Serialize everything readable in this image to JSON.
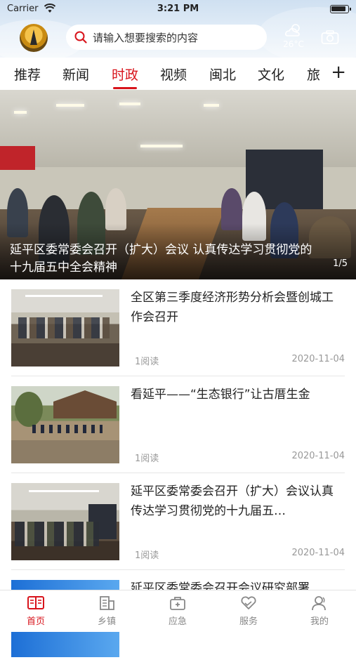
{
  "status_bar": {
    "carrier": "Carrier",
    "time": "3:21 PM"
  },
  "header": {
    "search_placeholder": "请输入想要搜索的内容",
    "weather_temp": "26°C"
  },
  "tabs": [
    {
      "label": "推荐",
      "active": false
    },
    {
      "label": "新闻",
      "active": false
    },
    {
      "label": "时政",
      "active": true
    },
    {
      "label": "视频",
      "active": false
    },
    {
      "label": "闽北",
      "active": false
    },
    {
      "label": "文化",
      "active": false
    },
    {
      "label": "旅",
      "active": false
    }
  ],
  "tabs_more": "+",
  "hero": {
    "title": "延平区委常委会召开（扩大）会议 认真传达学习贯彻党的十九届五中全会精神",
    "counter": "1/5"
  },
  "news": [
    {
      "title": "全区第三季度经济形势分析会暨创城工作会召开",
      "reads": "1阅读",
      "date": "2020-11-04"
    },
    {
      "title": "看延平——“生态银行”让古厝生金",
      "reads": "1阅读",
      "date": "2020-11-04"
    },
    {
      "title": "延平区委常委会召开（扩大）会议认真传达学习贯彻党的十九届五…",
      "reads": "1阅读",
      "date": "2020-11-04"
    },
    {
      "title": "延平区委常委会召开会议研究部署",
      "reads": "",
      "date": ""
    }
  ],
  "bottom_nav": [
    {
      "label": "首页",
      "icon": "book-icon",
      "active": true
    },
    {
      "label": "乡镇",
      "icon": "building-icon",
      "active": false
    },
    {
      "label": "应急",
      "icon": "medkit-icon",
      "active": false
    },
    {
      "label": "服务",
      "icon": "heart-hands-icon",
      "active": false
    },
    {
      "label": "我的",
      "icon": "user-icon",
      "active": false
    }
  ],
  "colors": {
    "accent": "#d8141c",
    "header_bg": "#dbe7f4"
  }
}
